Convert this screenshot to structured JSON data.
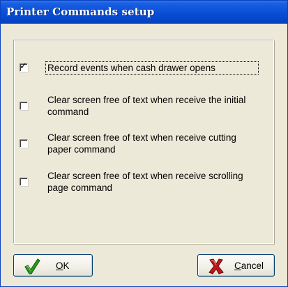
{
  "window": {
    "title": "Printer Commands setup"
  },
  "options": [
    {
      "label": "Record events when cash drawer opens",
      "checked": true
    },
    {
      "label": "Clear screen free of text when receive the initial command",
      "checked": false
    },
    {
      "label": "Clear screen free of text when receive cutting paper command",
      "checked": false
    },
    {
      "label": "Clear screen free of text when receive scrolling page command",
      "checked": false
    }
  ],
  "buttons": {
    "ok_label": "OK",
    "cancel_label": "Cancel",
    "ok_icon": "green-checkmark-icon",
    "cancel_icon": "red-x-icon"
  },
  "colors": {
    "titlebar": "#0a4fd8",
    "dialog_bg": "#ece9d8",
    "ok_icon": "#2a9a1c",
    "cancel_icon": "#c01818"
  }
}
